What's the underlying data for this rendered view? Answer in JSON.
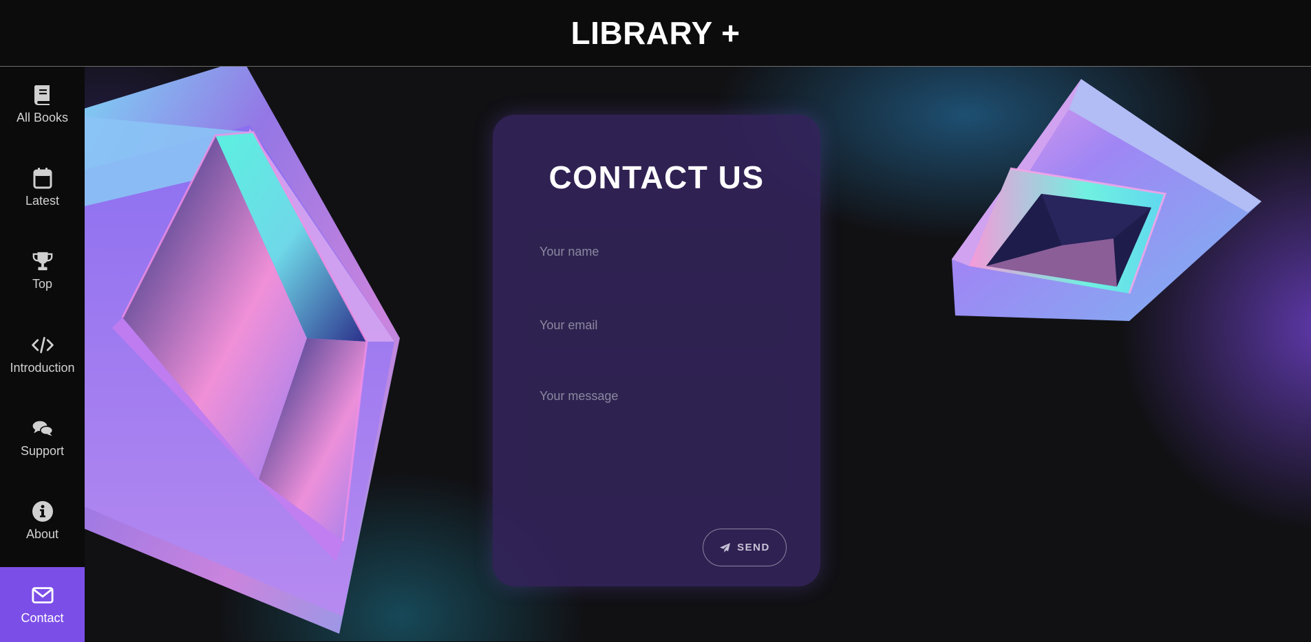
{
  "app": {
    "brand": "LIBRARY +"
  },
  "sidebar": {
    "items": [
      {
        "label": "All Books",
        "icon": "book-icon"
      },
      {
        "label": "Latest",
        "icon": "calendar-icon"
      },
      {
        "label": "Top",
        "icon": "trophy-icon"
      },
      {
        "label": "Introduction",
        "icon": "code-icon"
      },
      {
        "label": "Support",
        "icon": "chat-icon"
      },
      {
        "label": "About",
        "icon": "info-icon"
      },
      {
        "label": "Contact",
        "icon": "envelope-icon",
        "active": true
      }
    ]
  },
  "contact": {
    "title": "CONTACT US",
    "name_placeholder": "Your name",
    "email_placeholder": "Your email",
    "message_placeholder": "Your message",
    "send_label": "SEND"
  },
  "colors": {
    "accent": "#7c4ee8",
    "card": "#34235c",
    "field": "#2e2350",
    "background": "#111114"
  }
}
